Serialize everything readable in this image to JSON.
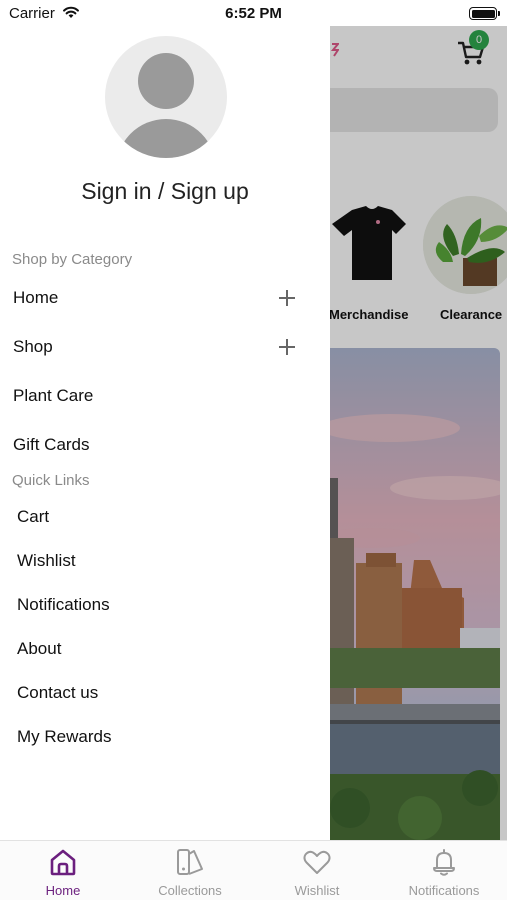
{
  "status_bar": {
    "carrier": "Carrier",
    "time": "6:52 PM"
  },
  "drawer": {
    "sign_in_label": "Sign in / Sign up",
    "category_section": {
      "title": "Shop by Category",
      "items": [
        {
          "label": "Home",
          "expandable": true
        },
        {
          "label": "Shop",
          "expandable": true
        },
        {
          "label": "Plant Care",
          "expandable": false
        },
        {
          "label": "Gift Cards",
          "expandable": false
        }
      ]
    },
    "quick_links": {
      "title": "Quick Links",
      "items": [
        {
          "label": "Cart"
        },
        {
          "label": "Wishlist"
        },
        {
          "label": "Notifications"
        },
        {
          "label": "About"
        },
        {
          "label": "Contact us"
        },
        {
          "label": "My Rewards"
        }
      ]
    }
  },
  "background": {
    "cart_badge": "0",
    "categories": [
      {
        "label": "Merchandise",
        "icon": "tshirt-image"
      },
      {
        "label": "Clearance",
        "icon": "plant-image"
      }
    ]
  },
  "tabbar": {
    "active_index": 0,
    "tabs": [
      {
        "label": "Home",
        "icon": "home-icon"
      },
      {
        "label": "Collections",
        "icon": "collections-icon"
      },
      {
        "label": "Wishlist",
        "icon": "heart-icon"
      },
      {
        "label": "Notifications",
        "icon": "bell-icon"
      }
    ]
  },
  "colors": {
    "accent": "#6b1f7e",
    "badge": "#2fa84f",
    "inactive": "#9a9a9a",
    "section_title": "#8a8a8a"
  }
}
